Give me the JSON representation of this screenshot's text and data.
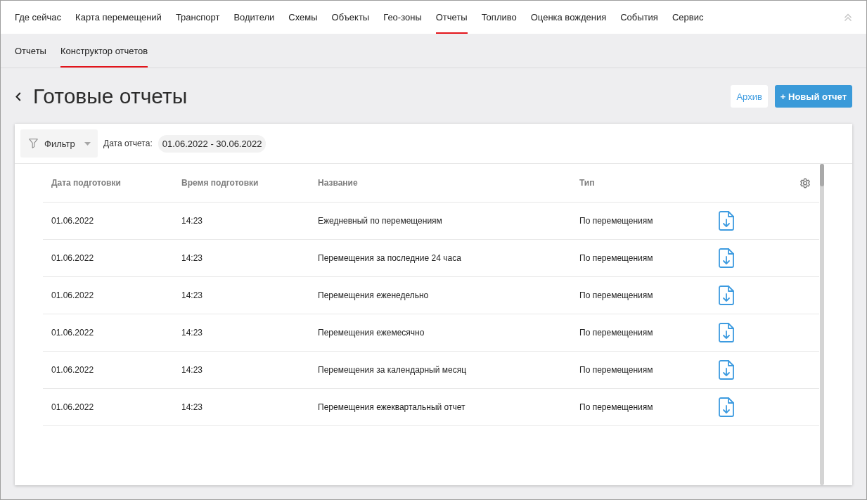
{
  "top_nav": {
    "items": [
      {
        "label": "Где сейчас",
        "selected": false
      },
      {
        "label": "Карта перемещений",
        "selected": false
      },
      {
        "label": "Транспорт",
        "selected": false
      },
      {
        "label": "Водители",
        "selected": false
      },
      {
        "label": "Схемы",
        "selected": false
      },
      {
        "label": "Объекты",
        "selected": false
      },
      {
        "label": "Гео-зоны",
        "selected": false
      },
      {
        "label": "Отчеты",
        "selected": true
      },
      {
        "label": "Топливо",
        "selected": false
      },
      {
        "label": "Оценка вождения",
        "selected": false
      },
      {
        "label": "События",
        "selected": false
      },
      {
        "label": "Сервис",
        "selected": false
      }
    ]
  },
  "sub_nav": {
    "items": [
      {
        "label": "Отчеты",
        "selected": false
      },
      {
        "label": "Конструктор отчетов",
        "selected": true
      }
    ]
  },
  "page": {
    "title": "Готовые отчеты",
    "buttons": [
      {
        "label": "Архив",
        "kind": "secondary"
      },
      {
        "label": "+ Новый отчет",
        "kind": "primary"
      }
    ]
  },
  "filter": {
    "button": "Фильтр",
    "date_label": "Дата отчета:",
    "date_range": "01.06.2022 - 30.06.2022"
  },
  "table": {
    "columns": [
      "Дата подготовки",
      "Время подготовки",
      "Название",
      "Тип"
    ],
    "rows": [
      {
        "date": "01.06.2022",
        "time": "14:23",
        "name": "Ежедневный по перемещениям",
        "type": "По перемещениям"
      },
      {
        "date": "01.06.2022",
        "time": "14:23",
        "name": "Перемещения за последние 24 часа",
        "type": "По перемещениям"
      },
      {
        "date": "01.06.2022",
        "time": "14:23",
        "name": "Перемещения еженедельно",
        "type": "По перемещениям"
      },
      {
        "date": "01.06.2022",
        "time": "14:23",
        "name": "Перемещения ежемесячно",
        "type": "По перемещениям"
      },
      {
        "date": "01.06.2022",
        "time": "14:23",
        "name": "Перемещения за календарный месяц",
        "type": "По перемещениям"
      },
      {
        "date": "01.06.2022",
        "time": "14:23",
        "name": "Перемещения ежеквартальный отчет",
        "type": "По перемещениям"
      }
    ]
  }
}
